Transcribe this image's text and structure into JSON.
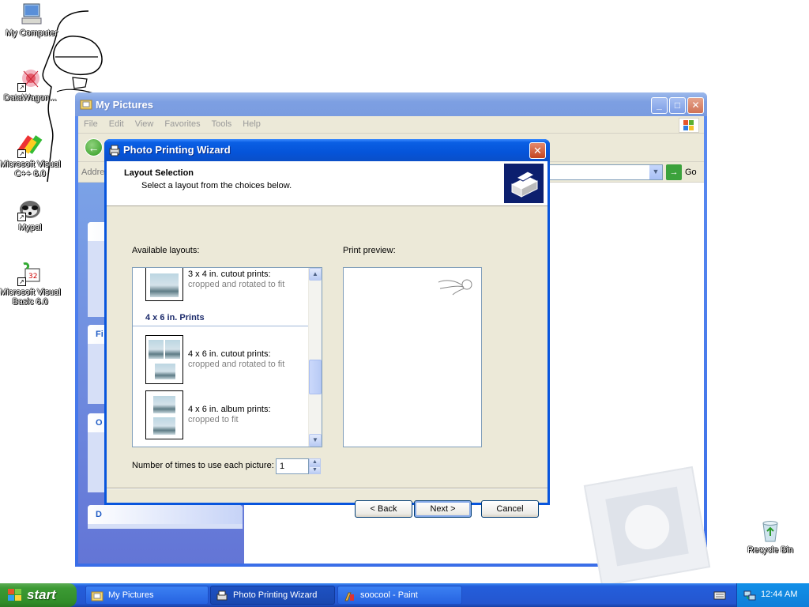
{
  "desktop": {
    "icons": [
      {
        "label": "My Computer"
      },
      {
        "label": "DataWagon..."
      },
      {
        "label": "Microsoft Visual C++ 6.0"
      },
      {
        "label": "Mypal"
      },
      {
        "label": "Microsoft Visual Basic 6.0"
      },
      {
        "label": "Recycle Bin"
      }
    ]
  },
  "explorer": {
    "title": "My Pictures",
    "menu": [
      "File",
      "Edit",
      "View",
      "Favorites",
      "Tools",
      "Help"
    ],
    "address_label": "Addre",
    "go_label": "Go",
    "task_headers": [
      "Fi",
      "O",
      "D"
    ]
  },
  "wizard": {
    "title": "Photo Printing Wizard",
    "header_title": "Layout Selection",
    "header_subtitle": "Select a layout from the choices below.",
    "available_label": "Available layouts:",
    "preview_label": "Print preview:",
    "layouts": [
      {
        "title": "3 x 4 in. cutout prints:",
        "subtitle": "cropped and rotated to fit"
      },
      {
        "title": "4 x 6 in. cutout prints:",
        "subtitle": "cropped and rotated to fit"
      },
      {
        "title": "4 x 6 in. album prints:",
        "subtitle": "cropped to fit"
      }
    ],
    "group_header": "4 x 6 in. Prints",
    "count_label": "Number of times to use each picture:",
    "count_value": "1",
    "buttons": {
      "back": "< Back",
      "next": "Next >",
      "cancel": "Cancel"
    }
  },
  "taskbar": {
    "start_label": "start",
    "tasks": [
      {
        "label": "My Pictures",
        "active": false
      },
      {
        "label": "Photo Printing Wizard",
        "active": true
      },
      {
        "label": "soocool - Paint",
        "active": false
      }
    ],
    "clock": "12:44 AM"
  }
}
